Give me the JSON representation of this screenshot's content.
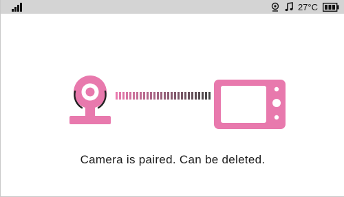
{
  "status_bar": {
    "temperature": "27°C",
    "signal_icon": "signal-strength-icon",
    "camera_icon": "camera-status-icon",
    "music_icon": "music-note-icon",
    "battery_icon": "battery-icon"
  },
  "pairing": {
    "message": "Camera is paired. Can be deleted.",
    "accent_color": "#e879ad",
    "camera_icon": "camera-icon",
    "monitor_icon": "monitor-icon"
  }
}
